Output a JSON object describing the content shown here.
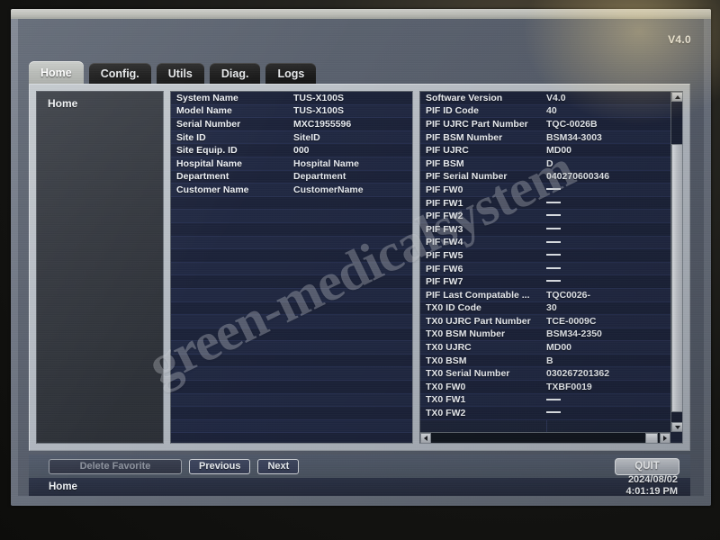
{
  "version_label": "V4.0",
  "watermark": "green-medicalsystem",
  "tabs": [
    {
      "label": "Home",
      "active": true
    },
    {
      "label": "Config.",
      "active": false
    },
    {
      "label": "Utils",
      "active": false
    },
    {
      "label": "Diag.",
      "active": false
    },
    {
      "label": "Logs",
      "active": false
    }
  ],
  "nav": {
    "title": "Home"
  },
  "left_table": {
    "rows": [
      {
        "label": "System Name",
        "value": "TUS-X100S"
      },
      {
        "label": "Model Name",
        "value": "TUS-X100S"
      },
      {
        "label": "Serial Number",
        "value": "MXC1955596"
      },
      {
        "label": "Site ID",
        "value": "SiteID"
      },
      {
        "label": "Site Equip. ID",
        "value": "000"
      },
      {
        "label": "Hospital Name",
        "value": "Hospital Name"
      },
      {
        "label": "Department",
        "value": "Department"
      },
      {
        "label": "Customer Name",
        "value": "CustomerName"
      }
    ],
    "empty_rows": 19
  },
  "right_table": {
    "rows": [
      {
        "label": "Software Version",
        "value": "V4.0"
      },
      {
        "label": "PIF ID Code",
        "value": "40"
      },
      {
        "label": "PIF UJRC Part Number",
        "value": "TQC-0026B"
      },
      {
        "label": "PIF BSM Number",
        "value": "BSM34-3003"
      },
      {
        "label": "PIF UJRC",
        "value": "MD00"
      },
      {
        "label": "PIF BSM",
        "value": "D"
      },
      {
        "label": "PIF Serial Number",
        "value": "040270600346"
      },
      {
        "label": "PIF FW0",
        "value": ""
      },
      {
        "label": "PIF FW1",
        "value": ""
      },
      {
        "label": "PIF FW2",
        "value": ""
      },
      {
        "label": "PIF FW3",
        "value": ""
      },
      {
        "label": "PIF FW4",
        "value": ""
      },
      {
        "label": "PIF FW5",
        "value": ""
      },
      {
        "label": "PIF FW6",
        "value": ""
      },
      {
        "label": "PIF FW7",
        "value": ""
      },
      {
        "label": "PIF Last Compatable ...",
        "value": "TQC0026-"
      },
      {
        "label": "TX0 ID Code",
        "value": "30"
      },
      {
        "label": "TX0 UJRC Part Number",
        "value": "TCE-0009C"
      },
      {
        "label": "TX0 BSM Number",
        "value": "BSM34-2350"
      },
      {
        "label": "TX0 UJRC",
        "value": "MD00"
      },
      {
        "label": "TX0 BSM",
        "value": "B"
      },
      {
        "label": "TX0 Serial Number",
        "value": "030267201362"
      },
      {
        "label": "TX0 FW0",
        "value": "TXBF0019"
      },
      {
        "label": "TX0 FW1",
        "value": ""
      },
      {
        "label": "TX0 FW2",
        "value": ""
      }
    ]
  },
  "buttons": {
    "delete_favorite": "Delete Favorite",
    "previous": "Previous",
    "next": "Next",
    "quit": "QUIT"
  },
  "status": {
    "text": "Home",
    "date": "2024/08/02",
    "time": "4:01:19 PM"
  },
  "colors": {
    "table_bg": "#1d2438",
    "frame": "#b4bac2",
    "accent": "#3f4760"
  }
}
